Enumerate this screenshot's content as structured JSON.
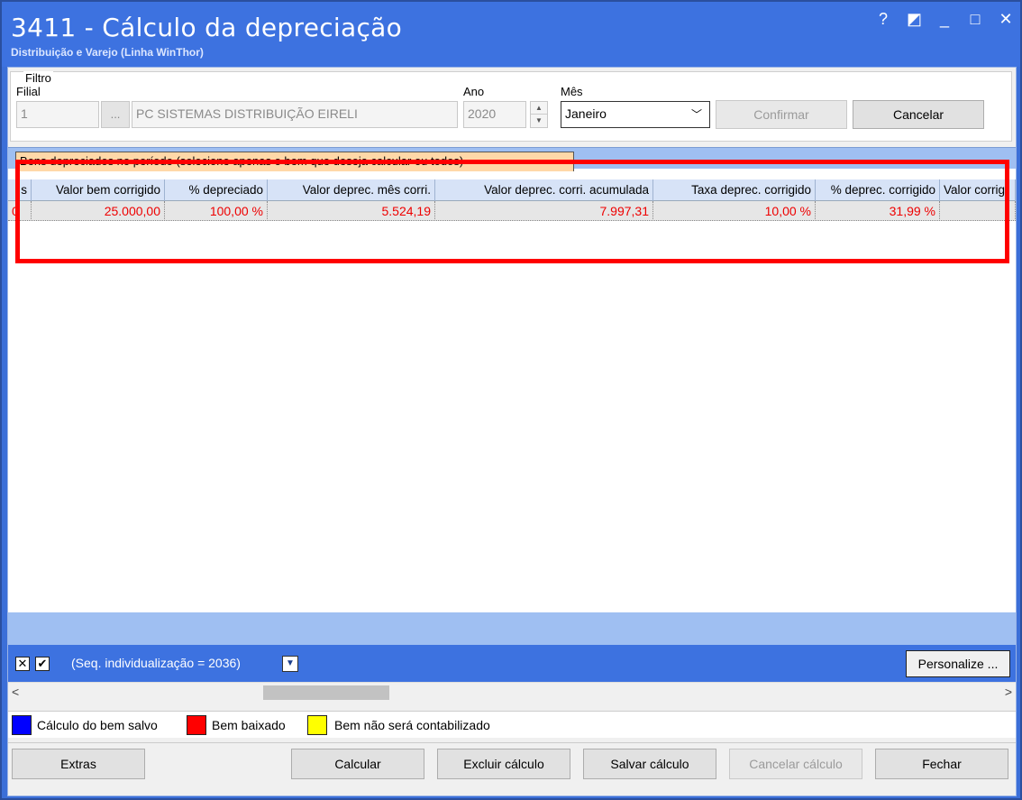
{
  "window": {
    "title": "3411 - Cálculo da depreciação",
    "subtitle": "Distribuição e Varejo (Linha WinThor)",
    "controls": [
      "?",
      "◩",
      "_",
      "□",
      "✕"
    ]
  },
  "filtro": {
    "legend": "Filtro",
    "filial_label": "Filial",
    "filial_code": "1",
    "filial_lookup": "...",
    "filial_name": "PC SISTEMAS DISTRIBUIÇÃO  EIRELI",
    "ano_label": "Ano",
    "ano_value": "2020",
    "mes_label": "Mês",
    "mes_value": "Janeiro",
    "confirmar": "Confirmar",
    "cancelar": "Cancelar"
  },
  "grid": {
    "tab_label": "Bens depreciados no período (selecione apenas o bem que deseja calcular ou todos)",
    "columns": [
      "s",
      "Valor bem corrigido",
      "% depreciado",
      "Valor deprec. mês corri.",
      "Valor deprec. corri. acumulada",
      "Taxa deprec. corrigido",
      "% deprec. corrigido",
      "Valor corrig"
    ],
    "rows": [
      [
        "0",
        "25.000,00",
        "100,00 %",
        "5.524,19",
        "7.997,31",
        "10,00 %",
        "31,99 %",
        ""
      ]
    ]
  },
  "filter_bar": {
    "text": "(Seq. individualização = 2036)",
    "personalize": "Personalize ..."
  },
  "legend": [
    {
      "color": "#0000ff",
      "label": "Cálculo do bem salvo"
    },
    {
      "color": "#ff0000",
      "label": "Bem baixado"
    },
    {
      "color": "#ffff00",
      "label": "Bem não será contabilizado"
    }
  ],
  "buttons": {
    "extras": "Extras",
    "calcular": "Calcular",
    "excluir": "Excluir cálculo",
    "salvar": "Salvar cálculo",
    "cancelar_calculo": "Cancelar cálculo",
    "fechar": "Fechar"
  }
}
